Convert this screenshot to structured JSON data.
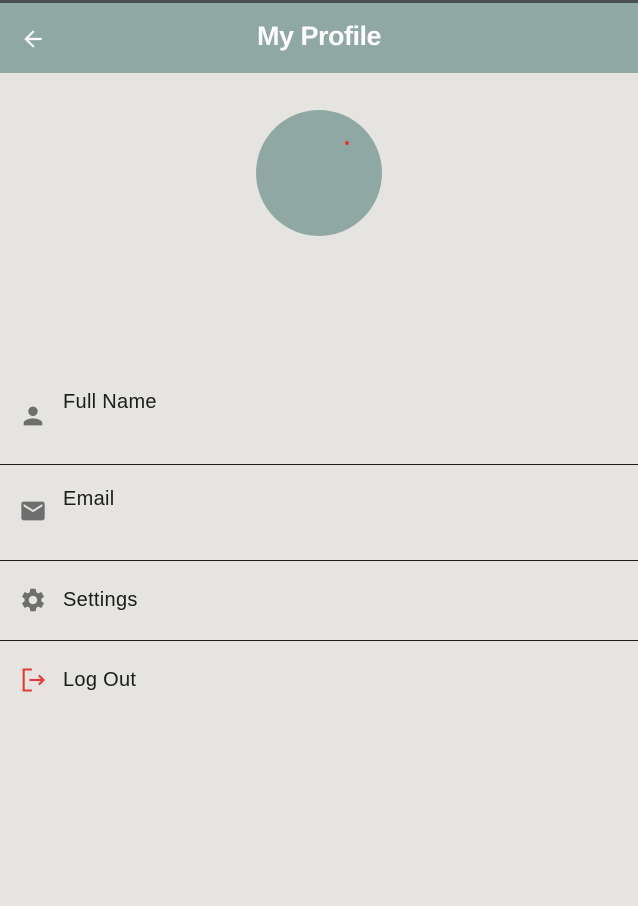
{
  "appbar": {
    "title": "My Profile",
    "back_icon": "arrow-back-icon",
    "background": "#8fa8a3"
  },
  "avatar": {
    "color": "#8fa8a3",
    "indicator_color": "#e53935"
  },
  "menu": {
    "items": [
      {
        "icon": "person-icon",
        "label": "Full Name"
      },
      {
        "icon": "mail-icon",
        "label": "Email"
      },
      {
        "icon": "gear-icon",
        "label": "Settings"
      },
      {
        "icon": "logout-icon",
        "label": "Log Out",
        "accent": "#e53935"
      }
    ]
  },
  "colors": {
    "page_background": "#e5e4e1",
    "icon_gray": "#6e6e6e",
    "divider": "#1d1d1d"
  }
}
